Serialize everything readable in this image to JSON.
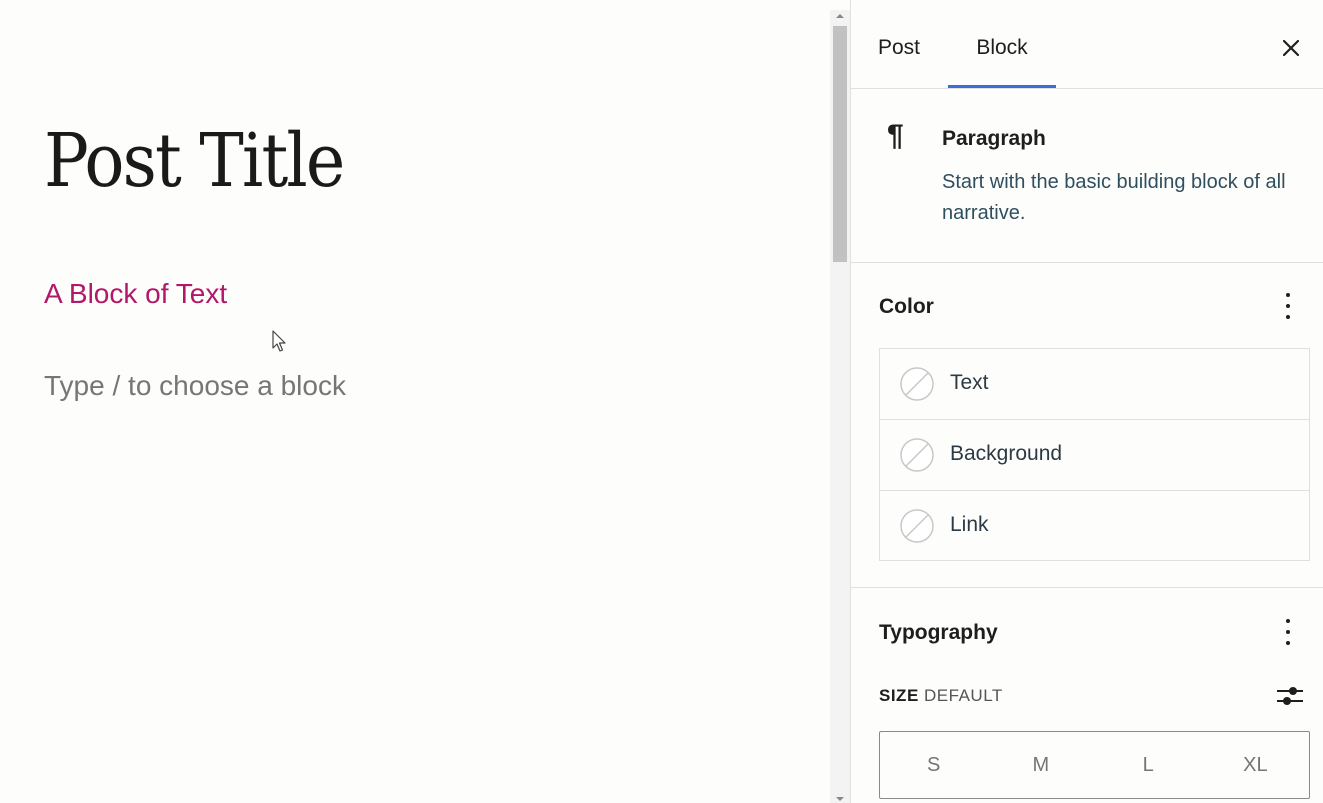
{
  "editor": {
    "post_title": "Post Title",
    "paragraph_text": "A Block of Text",
    "placeholder": "Type / to choose a block"
  },
  "sidebar": {
    "tabs": [
      {
        "label": "Post",
        "active": false
      },
      {
        "label": "Block",
        "active": true
      }
    ],
    "close_icon": "close-icon",
    "block_card": {
      "icon": "paragraph-icon",
      "name": "Paragraph",
      "description": "Start with the basic building block of all narrative."
    },
    "color_panel": {
      "title": "Color",
      "items": [
        {
          "label": "Text",
          "icon": "no-color-swatch-icon"
        },
        {
          "label": "Background",
          "icon": "no-color-swatch-icon"
        },
        {
          "label": "Link",
          "icon": "no-color-swatch-icon"
        }
      ]
    },
    "typography_panel": {
      "title": "Typography",
      "size_label": "SIZE",
      "size_value": "DEFAULT",
      "size_options": [
        "S",
        "M",
        "L",
        "XL"
      ]
    }
  },
  "colors": {
    "accent": "#3871d6",
    "paragraph_text": "#b2186a",
    "placeholder": "#767676"
  }
}
